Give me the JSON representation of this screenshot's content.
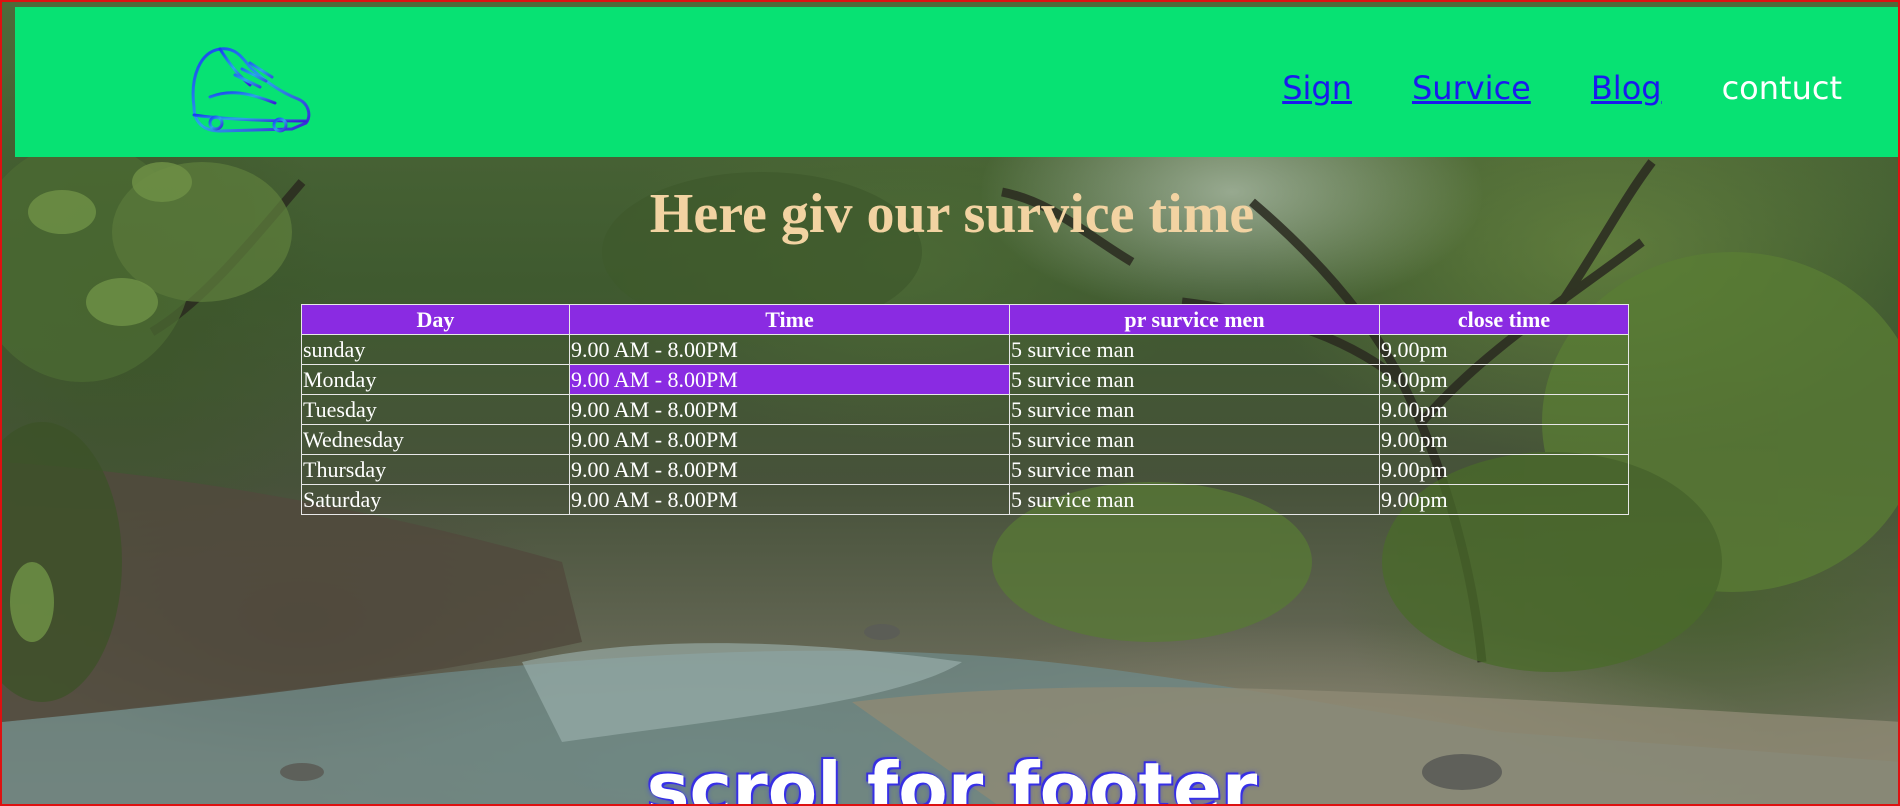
{
  "nav": {
    "sign": "Sign",
    "service": "Survice",
    "blog": "Blog",
    "contact": "contuct"
  },
  "heading": "Here giv our survice time",
  "table": {
    "headers": [
      "Day",
      "Time",
      "pr survice men",
      "close time"
    ],
    "rows": [
      [
        "sunday",
        "9.00 AM - 8.00PM",
        "5 survice man",
        "9.00pm"
      ],
      [
        "Monday",
        "9.00 AM - 8.00PM",
        "5 survice man",
        "9.00pm"
      ],
      [
        "Tuesday",
        "9.00 AM - 8.00PM",
        "5 survice man",
        "9.00pm"
      ],
      [
        "Wednesday",
        "9.00 AM - 8.00PM",
        "5 survice man",
        "9.00pm"
      ],
      [
        "Thursday",
        "9.00 AM - 8.00PM",
        "5 survice man",
        "9.00pm"
      ],
      [
        "Saturday",
        "9.00 AM - 8.00PM",
        "5 survice man",
        "9.00pm"
      ]
    ]
  },
  "scroll_text": "scrol for footer",
  "colors": {
    "header_bg": "#07e273",
    "table_header_bg": "#8a2be2",
    "heading_color": "#f2d3a2",
    "link_color": "#1a1aee"
  },
  "icons": {
    "logo": "sneaker-icon"
  }
}
